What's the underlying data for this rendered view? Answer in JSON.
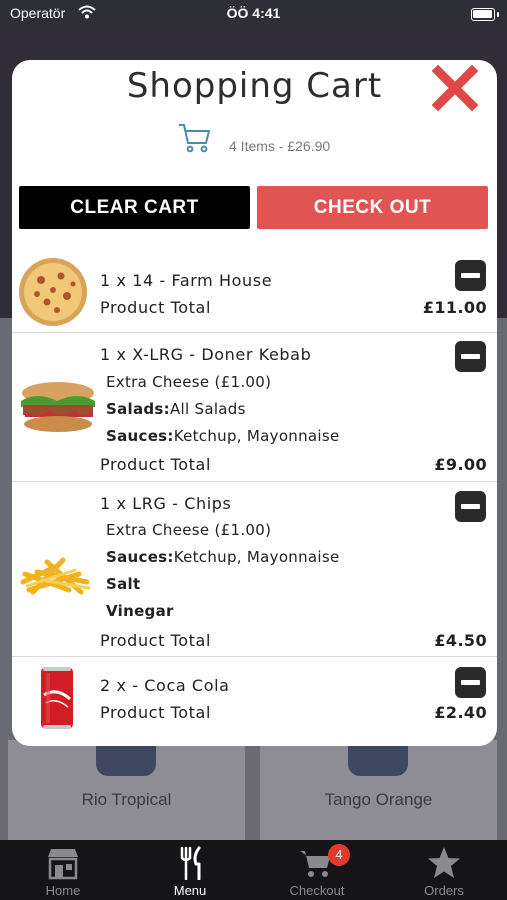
{
  "status_bar": {
    "carrier": "Operatör",
    "time": "ÖÖ 4:41"
  },
  "background": {
    "cards": [
      {
        "name": "Rio Tropical"
      },
      {
        "name": "Tango Orange"
      }
    ]
  },
  "modal": {
    "title": "Shopping Cart",
    "summary": "4 Items - £26.90",
    "clear_label": "CLEAR CART",
    "checkout_label": "CHECK OUT",
    "total_label": "Product Total",
    "items": [
      {
        "title": "1 x 14 - Farm House",
        "total": "£11.00",
        "image": "pizza"
      },
      {
        "title": "1 x X-LRG - Doner Kebab",
        "extra": "Extra Cheese (£1.00)",
        "salads_label": "Salads:",
        "salads_value": "All Salads",
        "sauces_label": "Sauces:",
        "sauces_value": "Ketchup, Mayonnaise",
        "total": "£9.00",
        "image": "kebab"
      },
      {
        "title": "1 x LRG - Chips",
        "extra": "Extra Cheese (£1.00)",
        "sauces_label": "Sauces:",
        "sauces_value": "Ketchup, Mayonnaise",
        "salt": "Salt",
        "vinegar": "Vinegar",
        "total": "£4.50",
        "image": "chips"
      },
      {
        "title": "2 x - Coca Cola",
        "total": "£2.40",
        "image": "cola-can"
      }
    ]
  },
  "tabbar": {
    "tabs": [
      {
        "label": "Home",
        "icon": "store-icon"
      },
      {
        "label": "Menu",
        "icon": "cutlery-icon",
        "active": true
      },
      {
        "label": "Checkout",
        "icon": "cart-icon",
        "badge": "4"
      },
      {
        "label": "Orders",
        "icon": "star-icon"
      }
    ]
  },
  "colors": {
    "accent": "#e05551",
    "close": "#e04848",
    "dark": "#000000"
  }
}
